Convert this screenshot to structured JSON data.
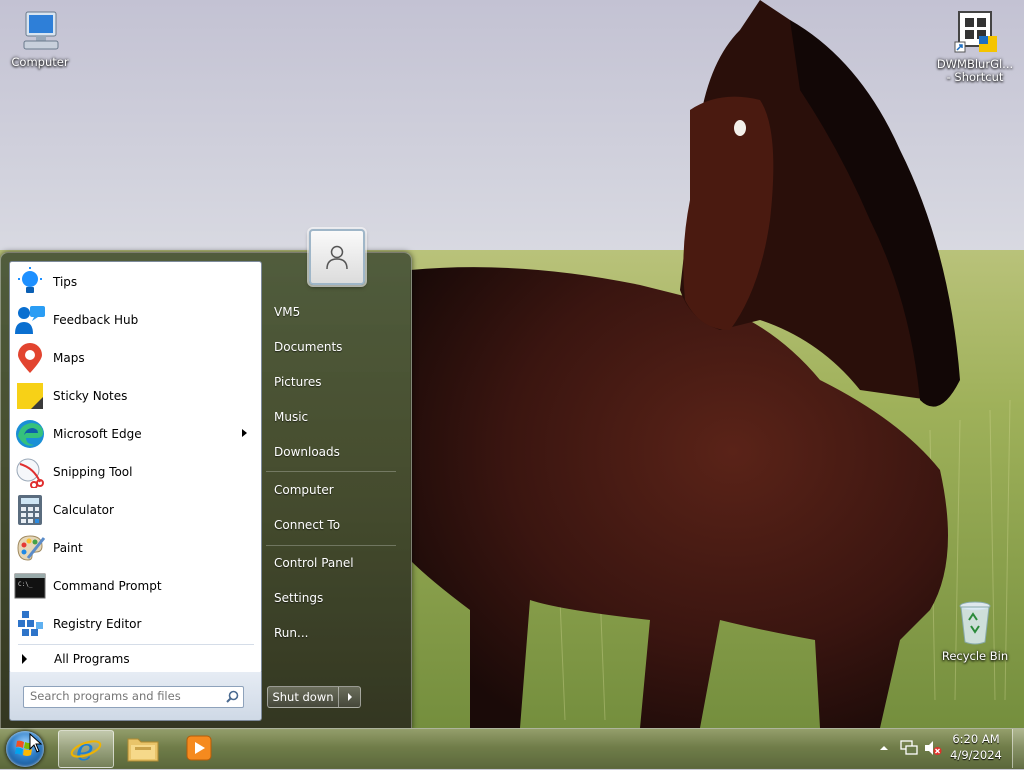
{
  "desktop": {
    "icons": [
      {
        "label": "Computer",
        "icon": "computer-icon"
      },
      {
        "label": "DWMBlurGl... - Shortcut",
        "icon": "dwm-shortcut-icon"
      },
      {
        "label": "Recycle Bin",
        "icon": "recycle-bin-icon"
      }
    ]
  },
  "start_menu": {
    "programs": [
      {
        "label": "Tips",
        "icon": "lightbulb-icon"
      },
      {
        "label": "Feedback Hub",
        "icon": "feedback-icon"
      },
      {
        "label": "Maps",
        "icon": "map-pin-icon"
      },
      {
        "label": "Sticky Notes",
        "icon": "sticky-note-icon"
      },
      {
        "label": "Microsoft Edge",
        "icon": "edge-icon"
      },
      {
        "label": "Snipping Tool",
        "icon": "scissors-icon"
      },
      {
        "label": "Calculator",
        "icon": "calculator-icon"
      },
      {
        "label": "Paint",
        "icon": "palette-icon"
      },
      {
        "label": "Command Prompt",
        "icon": "terminal-icon"
      },
      {
        "label": "Registry Editor",
        "icon": "registry-icon"
      }
    ],
    "all_programs": "All Programs",
    "search_placeholder": "Search programs and files",
    "right_items": [
      "VM5",
      "Documents",
      "Pictures",
      "Music",
      "Downloads",
      "Computer",
      "Connect To",
      "Control Panel",
      "Settings",
      "Run..."
    ],
    "shutdown_label": "Shut down"
  },
  "taskbar": {
    "pinned": [
      "internet-explorer-icon",
      "file-explorer-icon",
      "media-player-icon"
    ],
    "tray_icons": [
      "show-hidden-icons-icon",
      "network-icon",
      "volume-muted-icon"
    ],
    "time": "6:20 AM",
    "date": "4/9/2024"
  },
  "colors": {
    "taskbar": "#7a8650",
    "start_menu": "#48543a",
    "sky": "#c9c9d6",
    "grass": "#8fa850"
  }
}
